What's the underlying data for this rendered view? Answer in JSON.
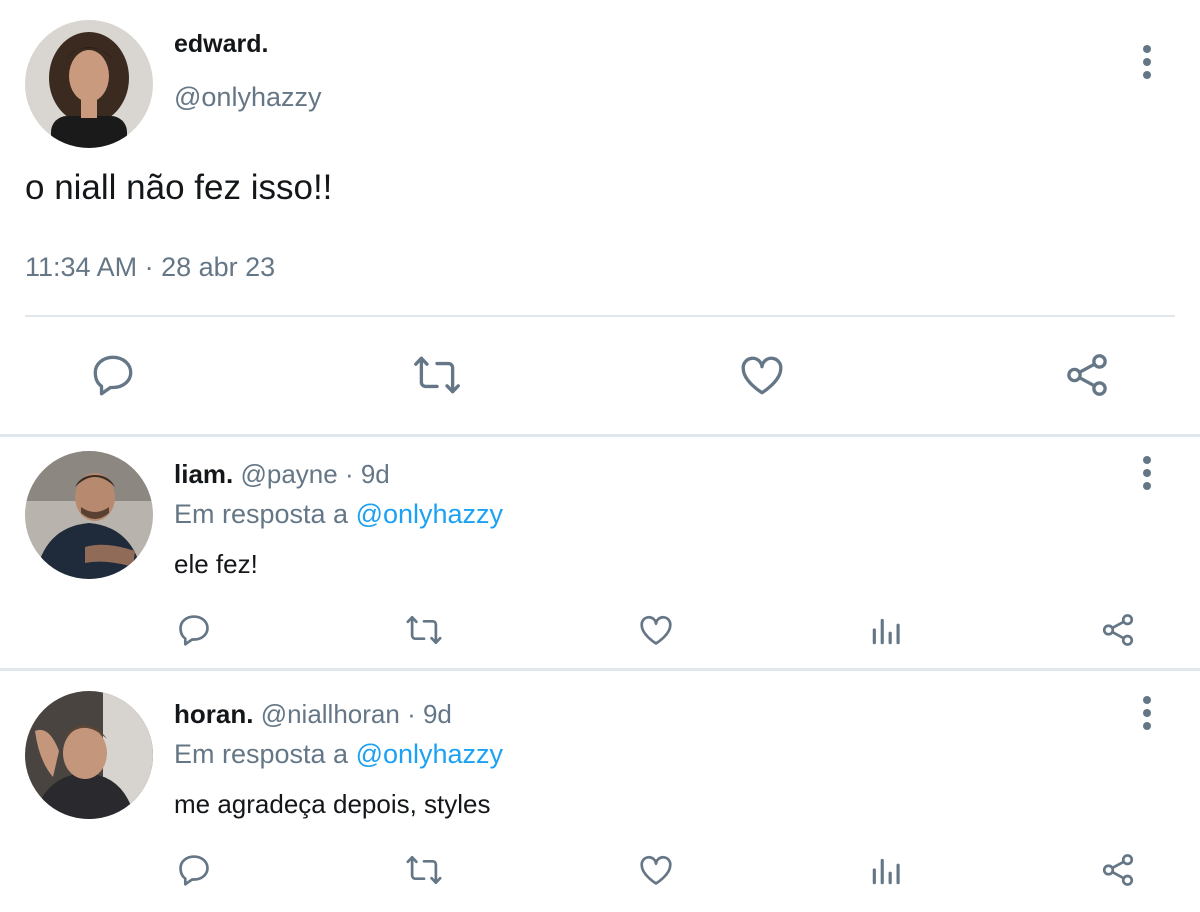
{
  "main_tweet": {
    "name": "edward.",
    "handle": "@onlyhazzy",
    "text": "o niall não fez isso!!",
    "timestamp": "11:34 AM · 28 abr 23",
    "actions": [
      "reply-icon",
      "retweet-icon",
      "like-icon",
      "share-icon"
    ]
  },
  "replies": [
    {
      "name": "liam.",
      "handle": "@payne",
      "time": "· 9d",
      "context_prefix": "Em resposta a ",
      "context_mention": "@onlyhazzy",
      "text": "ele fez!",
      "actions": [
        "reply-icon",
        "retweet-icon",
        "like-icon",
        "analytics-icon",
        "share-icon"
      ]
    },
    {
      "name": "horan.",
      "handle": "@niallhoran",
      "time": "· 9d",
      "context_prefix": "Em resposta a ",
      "context_mention": "@onlyhazzy",
      "text": "me agradeça depois, styles",
      "actions": [
        "reply-icon",
        "retweet-icon",
        "like-icon",
        "analytics-icon",
        "share-icon"
      ]
    }
  ],
  "colors": {
    "text": "#14171a",
    "secondary": "#657786",
    "link": "#1da1f2",
    "divider": "#e1e8ed",
    "background": "#ffffff"
  }
}
